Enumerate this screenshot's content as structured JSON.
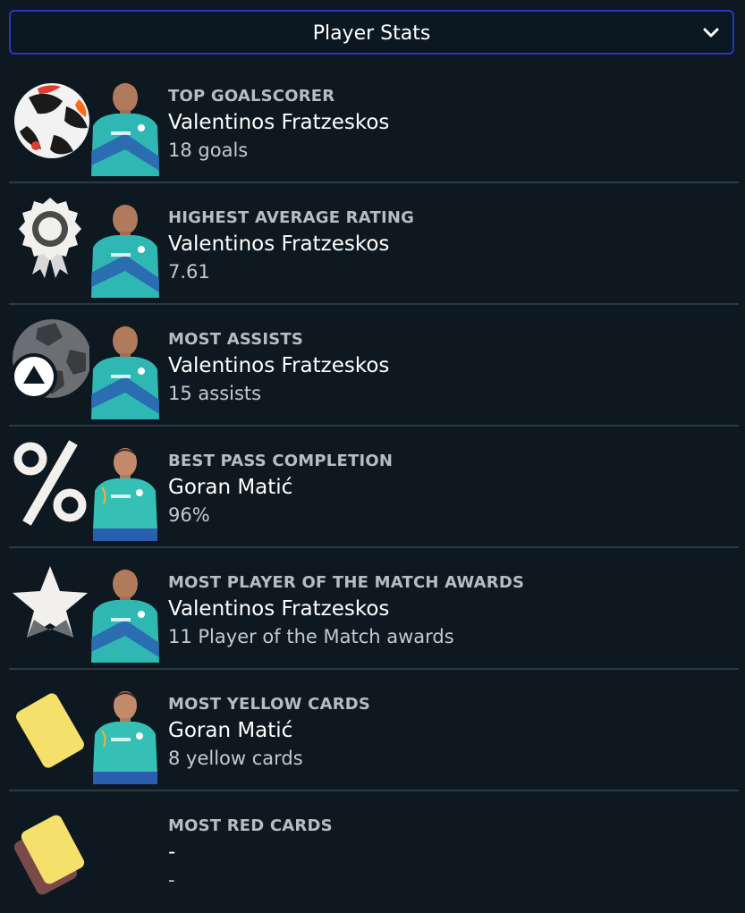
{
  "dropdown": {
    "label": "Player Stats",
    "icon": "chevron-down-icon"
  },
  "stats": [
    {
      "label": "TOP GOALSCORER",
      "player": "Valentinos Fratzeskos",
      "value": "18 goals",
      "icon": "football-icon"
    },
    {
      "label": "HIGHEST AVERAGE RATING",
      "player": "Valentinos Fratzeskos",
      "value": "7.61",
      "icon": "rosette-icon"
    },
    {
      "label": "MOST ASSISTS",
      "player": "Valentinos Fratzeskos",
      "value": "15 assists",
      "icon": "assist-icon"
    },
    {
      "label": "BEST PASS COMPLETION",
      "player": "Goran Matić",
      "value": "96%",
      "icon": "percent-icon"
    },
    {
      "label": "MOST PLAYER OF THE MATCH AWARDS",
      "player": "Valentinos Fratzeskos",
      "value": "11 Player of the Match awards",
      "icon": "star-icon"
    },
    {
      "label": "MOST YELLOW CARDS",
      "player": "Goran Matić",
      "value": "8 yellow cards",
      "icon": "yellow-card-icon"
    },
    {
      "label": "MOST RED CARDS",
      "player": "-",
      "value": "-",
      "icon": "red-card-icon"
    }
  ],
  "colors": {
    "background": "#0d1820",
    "accent_border": "#2a34c8",
    "divider": "#2e3a43",
    "kit_teal": "#2fb8b3",
    "kit_blue": "#2a5fb0",
    "yellow_card": "#f4e06a",
    "red_card": "#7a4a4a"
  }
}
